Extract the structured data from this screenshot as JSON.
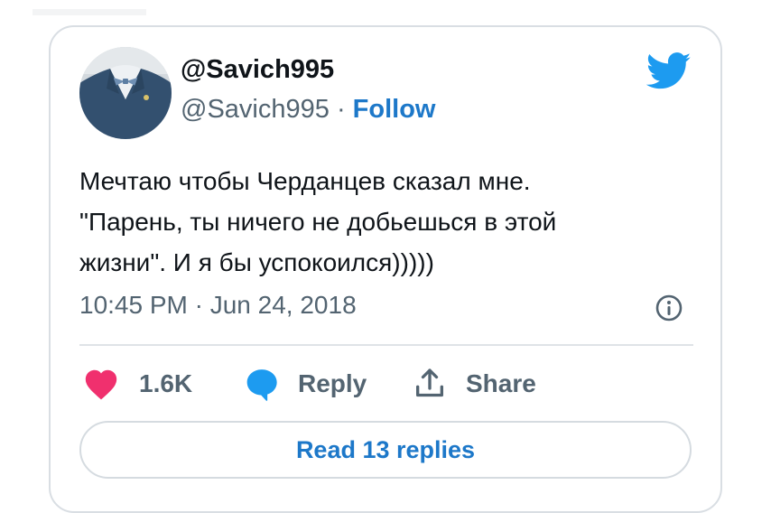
{
  "tweet": {
    "author": {
      "display_name": "@Savich995",
      "handle": "@Savich995",
      "separator": "·",
      "follow_label": "Follow"
    },
    "text_lines": [
      "Мечтаю чтобы Черданцев сказал мне.",
      "\"Парень, ты ничего не добьешься в этой",
      "жизни\". И я бы успокоился)))))"
    ],
    "timestamp": "10:45 PM · Jun 24, 2018",
    "actions": {
      "like_count": "1.6K",
      "reply_label": "Reply",
      "share_label": "Share"
    },
    "read_replies_label": "Read 13 replies"
  },
  "colors": {
    "brand_blue": "#1d9bf0",
    "link_blue": "#1d78c9",
    "like_pink": "#f0306e",
    "text_primary": "#0f1419",
    "text_secondary": "#536471"
  },
  "icons": [
    "twitter-bird-icon",
    "info-icon",
    "heart-icon",
    "reply-bubble-icon",
    "share-icon"
  ]
}
